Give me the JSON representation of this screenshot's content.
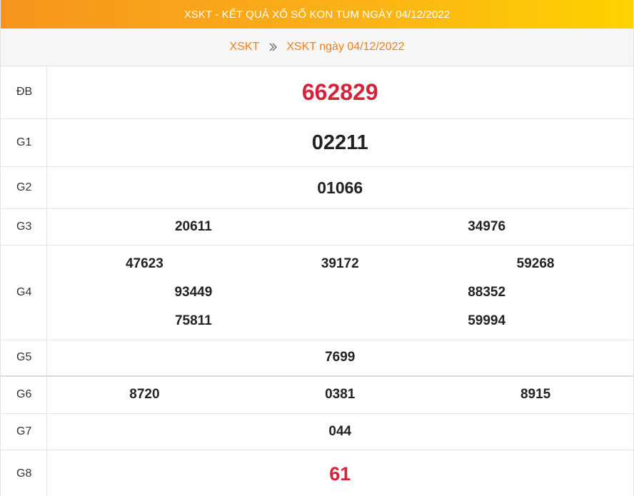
{
  "header": {
    "title": "XSKT - KẾT QUẢ XỔ SỐ KON TUM NGÀY 04/12/2022"
  },
  "breadcrumb": {
    "home": "XSKT",
    "current": "XSKT ngày 04/12/2022",
    "separator_icon": "double-chevron-right-icon"
  },
  "colors": {
    "accent": "#f7941d",
    "accent_end": "#ffd200",
    "link": "#f07d1a",
    "prize_red": "#d3243a"
  },
  "prizes": {
    "db": {
      "label": "ĐB",
      "numbers": [
        "662829"
      ]
    },
    "g1": {
      "label": "G1",
      "numbers": [
        "02211"
      ]
    },
    "g2": {
      "label": "G2",
      "numbers": [
        "01066"
      ]
    },
    "g3": {
      "label": "G3",
      "numbers": [
        "20611",
        "34976"
      ]
    },
    "g4": {
      "label": "G4",
      "row1": [
        "47623",
        "39172",
        "59268"
      ],
      "row2": [
        "93449",
        "88352"
      ],
      "row3": [
        "75811",
        "59994"
      ]
    },
    "g5": {
      "label": "G5",
      "numbers": [
        "7699"
      ]
    },
    "g6": {
      "label": "G6",
      "numbers": [
        "8720",
        "0381",
        "8915"
      ]
    },
    "g7": {
      "label": "G7",
      "numbers": [
        "044"
      ]
    },
    "g8": {
      "label": "G8",
      "numbers": [
        "61"
      ]
    }
  }
}
